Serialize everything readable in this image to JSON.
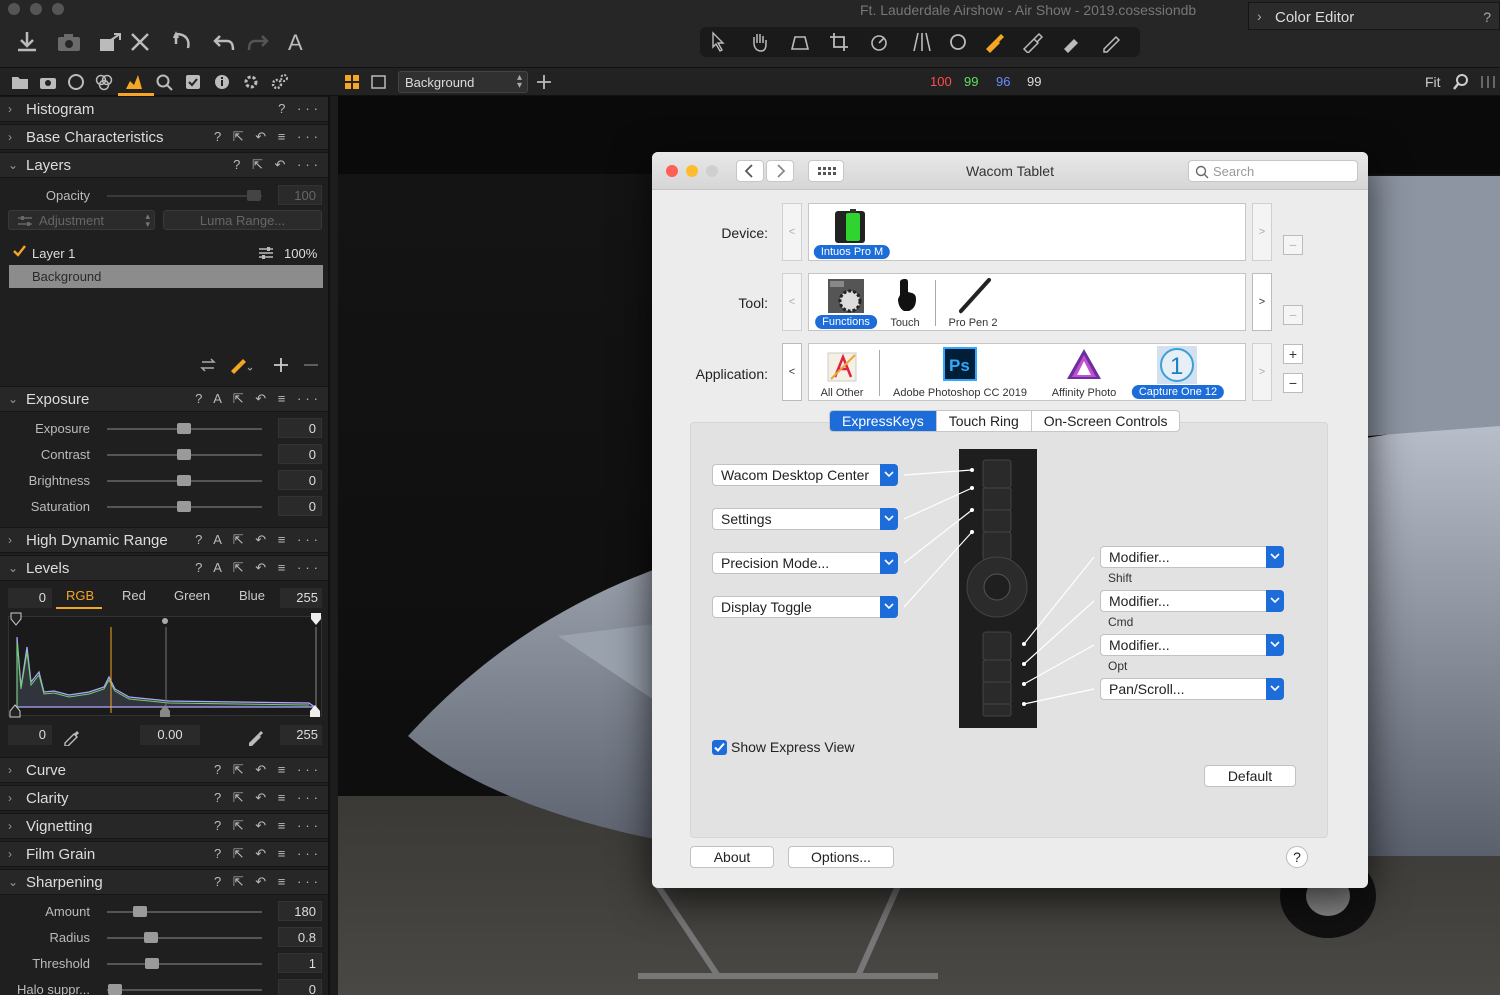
{
  "app": {
    "doc_title": "Ft. Lauderdale Airshow - Air Show - 2019.cosessiondb",
    "color_editor": "Color Editor",
    "layer_select": "Background",
    "readout": {
      "r": "100",
      "g": "99",
      "b": "96",
      "l": "99"
    },
    "zoom": "Fit",
    "colors": {
      "r": "#ff4d4d",
      "g": "#5ee05e",
      "b": "#6a8cff",
      "l": "#dddddd",
      "accent": "#f6a623"
    }
  },
  "left": {
    "histogram": "Histogram",
    "base": "Base Characteristics",
    "layers": {
      "title": "Layers",
      "opacity_label": "Opacity",
      "opacity_value": "100",
      "adjustment": "Adjustment",
      "luma": "Luma Range...",
      "layer1": "Layer 1",
      "layer1_pct": "100%",
      "background": "Background"
    },
    "exposure": {
      "title": "Exposure",
      "rows": [
        {
          "label": "Exposure",
          "value": "0"
        },
        {
          "label": "Contrast",
          "value": "0"
        },
        {
          "label": "Brightness",
          "value": "0"
        },
        {
          "label": "Saturation",
          "value": "0"
        }
      ]
    },
    "hdr": "High Dynamic Range",
    "levels": {
      "title": "Levels",
      "low": "0",
      "high": "255",
      "tabs": [
        "RGB",
        "Red",
        "Green",
        "Blue"
      ],
      "out_low": "0",
      "mid": "0.00",
      "out_high": "255"
    },
    "curve": "Curve",
    "clarity": "Clarity",
    "vignetting": "Vignetting",
    "film_grain": "Film Grain",
    "sharpening": {
      "title": "Sharpening",
      "rows": [
        {
          "label": "Amount",
          "value": "180"
        },
        {
          "label": "Radius",
          "value": "0.8"
        },
        {
          "label": "Threshold",
          "value": "1"
        },
        {
          "label": "Halo suppr...",
          "value": "0"
        }
      ]
    }
  },
  "dialog": {
    "title": "Wacom Tablet",
    "search_placeholder": "Search",
    "device_label": "Device:",
    "tool_label": "Tool:",
    "app_label": "Application:",
    "device": "Intuos Pro M",
    "tools": [
      "Functions",
      "Touch",
      "Pro Pen 2"
    ],
    "apps": [
      "All Other",
      "Adobe Photoshop CC 2019",
      "Affinity Photo",
      "Capture One 12"
    ],
    "tabs": [
      "ExpressKeys",
      "Touch Ring",
      "On-Screen Controls"
    ],
    "left_keys": [
      "Wacom Desktop Center",
      "Settings",
      "Precision Mode...",
      "Display Toggle"
    ],
    "right_keys": [
      {
        "value": "Modifier...",
        "sub": "Shift"
      },
      {
        "value": "Modifier...",
        "sub": "Cmd"
      },
      {
        "value": "Modifier...",
        "sub": "Opt"
      },
      {
        "value": "Pan/Scroll...",
        "sub": ""
      }
    ],
    "show_express": "Show Express View",
    "default": "Default",
    "about": "About",
    "options": "Options...",
    "help": "?"
  }
}
